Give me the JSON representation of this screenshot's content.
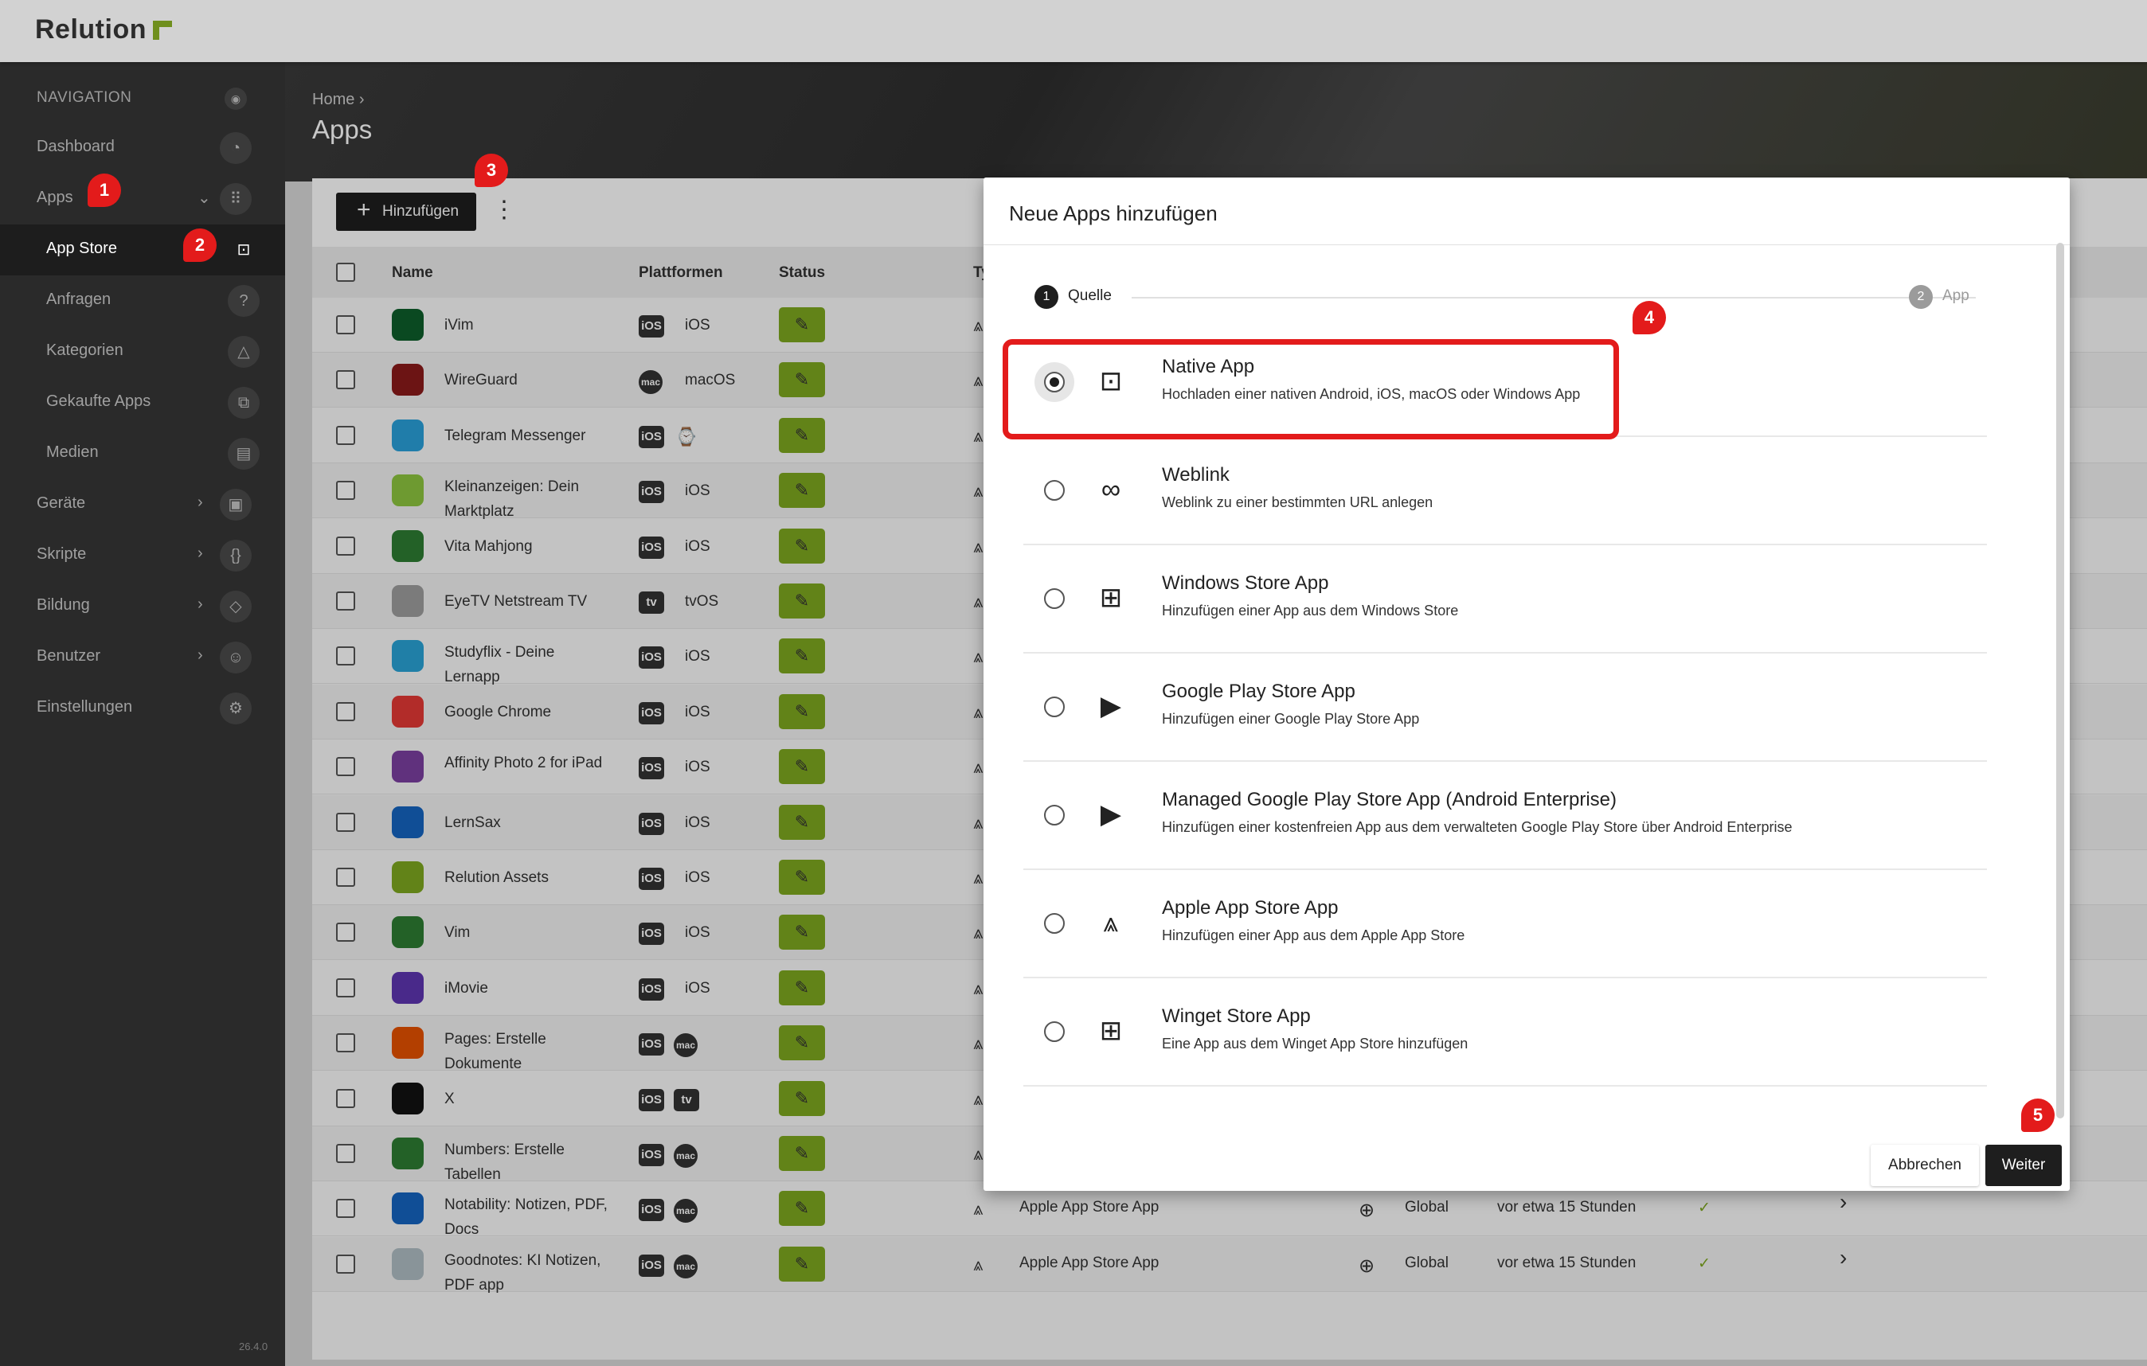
{
  "app": {
    "brand": "Relution"
  },
  "sidebar": {
    "heading": "NAVIGATION",
    "items": [
      {
        "label": "Dashboard",
        "icon": "gauge-icon"
      },
      {
        "label": "Apps",
        "icon": "grid-icon"
      },
      {
        "label": "App Store",
        "icon": "store-icon"
      },
      {
        "label": "Anfragen",
        "icon": "question-icon"
      },
      {
        "label": "Kategorien",
        "icon": "shapes-icon"
      },
      {
        "label": "Gekaufte Apps",
        "icon": "purchased-icon"
      },
      {
        "label": "Medien",
        "icon": "book-icon"
      },
      {
        "label": "Geräte",
        "icon": "devices-icon"
      },
      {
        "label": "Skripte",
        "icon": "code-icon"
      },
      {
        "label": "Bildung",
        "icon": "graduation-icon"
      },
      {
        "label": "Benutzer",
        "icon": "users-icon"
      },
      {
        "label": "Einstellungen",
        "icon": "gear-icon"
      }
    ],
    "version": "26.4.0"
  },
  "badges": [
    "1",
    "2",
    "3",
    "4",
    "5"
  ],
  "breadcrumb": {
    "home": "Home",
    "sep": "›"
  },
  "page": {
    "title": "Apps"
  },
  "toolbar": {
    "add_label": "Hinzufügen"
  },
  "table": {
    "columns": [
      "Name",
      "Plattformen",
      "Status",
      "Ty"
    ],
    "rows": [
      {
        "name": "iVim",
        "plat": "iOS",
        "ptext": "iOS",
        "color": "#0d5e2b"
      },
      {
        "name": "WireGuard",
        "plat": "mac",
        "ptext": "macOS",
        "color": "#8b1a1a"
      },
      {
        "name": "Telegram Messenger",
        "plat": "iOS",
        "ptext": "",
        "color": "#2aa1da"
      },
      {
        "name": "Kleinanzeigen: Dein Marktplatz",
        "plat": "iOS",
        "ptext": "iOS",
        "color": "#8dc63f"
      },
      {
        "name": "Vita Mahjong",
        "plat": "iOS",
        "ptext": "iOS",
        "color": "#2e7d32"
      },
      {
        "name": "EyeTV Netstream TV",
        "plat": "tv",
        "ptext": "tvOS",
        "color": "#9e9e9e"
      },
      {
        "name": "Studyflix - Deine Lernapp",
        "plat": "iOS",
        "ptext": "iOS",
        "color": "#29a3d6"
      },
      {
        "name": "Google Chrome",
        "plat": "iOS",
        "ptext": "iOS",
        "color": "#e53935"
      },
      {
        "name": "Affinity Photo 2 for iPad",
        "plat": "iOS",
        "ptext": "iOS",
        "color": "#7b3fa0"
      },
      {
        "name": "LernSax",
        "plat": "iOS",
        "ptext": "iOS",
        "color": "#1565c0"
      },
      {
        "name": "Relution Assets",
        "plat": "iOS",
        "ptext": "iOS",
        "color": "#7ea81f"
      },
      {
        "name": "Vim",
        "plat": "iOS",
        "ptext": "iOS",
        "color": "#2e7d32"
      },
      {
        "name": "iMovie",
        "plat": "iOS",
        "ptext": "iOS",
        "color": "#5e35b1"
      },
      {
        "name": "Pages: Erstelle Dokumente",
        "plat": "iOS",
        "ptext": "",
        "color": "#e65100"
      },
      {
        "name": "X",
        "plat": "iOS",
        "ptext": "",
        "color": "#111111"
      },
      {
        "name": "Numbers: Erstelle Tabellen",
        "plat": "iOS",
        "ptext": "",
        "color": "#2e7d32"
      },
      {
        "name": "Notability: Notizen, PDF, Docs",
        "plat": "iOS",
        "ptext": "",
        "color": "#1565c0"
      },
      {
        "name": "Goodnotes: KI Notizen, PDF app",
        "plat": "iOS",
        "ptext": "",
        "color": "#b0bec5"
      }
    ],
    "extra": {
      "type": "Apple App Store App",
      "scope": "Global",
      "time": "vor etwa 15 Stunden",
      "check": "✓",
      "arrow": "›"
    }
  },
  "modal": {
    "title": "Neue Apps hinzufügen",
    "steps": [
      {
        "num": "1",
        "label": "Quelle"
      },
      {
        "num": "2",
        "label": "App"
      }
    ],
    "options": [
      {
        "title": "Native App",
        "desc": "Hochladen einer nativen Android, iOS, macOS oder Windows App",
        "icon": "upload-box-icon"
      },
      {
        "title": "Weblink",
        "desc": "Weblink zu einer bestimmten URL anlegen",
        "icon": "link-icon"
      },
      {
        "title": "Windows Store App",
        "desc": "Hinzufügen einer App aus dem Windows Store",
        "icon": "windows-icon"
      },
      {
        "title": "Google Play Store App",
        "desc": "Hinzufügen einer Google Play Store App",
        "icon": "google-play-icon"
      },
      {
        "title": "Managed Google Play Store App (Android Enterprise)",
        "desc": "Hinzufügen einer kostenfreien App aus dem verwalteten Google Play Store über Android Enterprise",
        "icon": "google-play-icon"
      },
      {
        "title": "Apple App Store App",
        "desc": "Hinzufügen einer App aus dem Apple App Store",
        "icon": "app-store-icon"
      },
      {
        "title": "Winget Store App",
        "desc": "Eine App aus dem Winget App Store hinzufügen",
        "icon": "windows-icon"
      }
    ],
    "cancel_label": "Abbrechen",
    "next_label": "Weiter"
  }
}
